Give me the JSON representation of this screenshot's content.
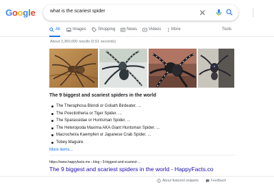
{
  "logo": {
    "letters": [
      "G",
      "o",
      "o",
      "g",
      "l",
      "e"
    ],
    "colors": [
      "#4285f4",
      "#ea4335",
      "#fbbc05",
      "#4285f4",
      "#34a853",
      "#ea4335"
    ]
  },
  "search": {
    "query": "what is the scariest spider"
  },
  "tabs": {
    "items": [
      {
        "label": "All",
        "icon": "search-icon",
        "active": true
      },
      {
        "label": "Images",
        "icon": "image-icon"
      },
      {
        "label": "Shopping",
        "icon": "tag-icon"
      },
      {
        "label": "News",
        "icon": "news-icon"
      },
      {
        "label": "Videos",
        "icon": "play-icon"
      },
      {
        "label": "More",
        "icon": "more-vert-icon"
      }
    ],
    "tools": "Tools"
  },
  "stats": "About 3,360,000 results (0.51 seconds)",
  "featured": {
    "title": "The 9 biggest and scariest spiders in the world",
    "items": [
      "The Theraphosa Blondi or Goliath Birdeater. ...",
      "The Poecilotheria or Tiger Spider. ...",
      "The Sparassidae or Huntsman Spider. ...",
      "The Heteropoda Maxima AKA Giant Huntsman Spider. ...",
      "Macrocheira Kaempferi or Japanese Crab Spider. ...",
      "Tobey Maguire."
    ],
    "more": "More items..."
  },
  "result": {
    "cite": "https://www.happyfacts.me › blog › 9-biggest-and-scariest-...",
    "title": "The 9 biggest and scariest spiders in the world - HappyFacts.co"
  },
  "footer": {
    "about": "About featured snippets",
    "feedback": "Feedback"
  },
  "colors": {
    "link": "#1a0dab",
    "accent": "#1a73e8"
  }
}
